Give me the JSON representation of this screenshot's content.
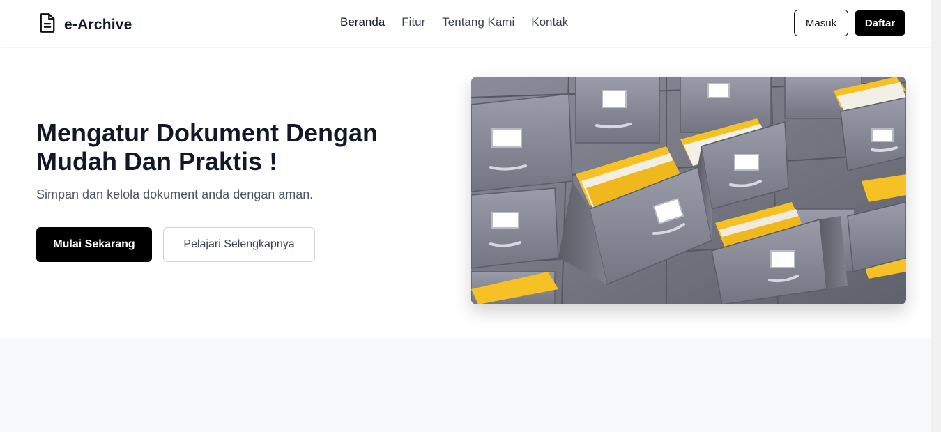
{
  "header": {
    "brand": "e-Archive",
    "nav": [
      {
        "label": "Beranda",
        "active": true
      },
      {
        "label": "Fitur",
        "active": false
      },
      {
        "label": "Tentang Kami",
        "active": false
      },
      {
        "label": "Kontak",
        "active": false
      }
    ],
    "login_label": "Masuk",
    "register_label": "Daftar"
  },
  "hero": {
    "title_line1": "Mengatur Dokument Dengan",
    "title_line2": "Mudah Dan Praktis !",
    "subtitle": "Simpan dan kelola dokument anda dengan aman.",
    "primary_cta": "Mulai Sekarang",
    "secondary_cta": "Pelajari Selengkapnya"
  },
  "colors": {
    "primary": "#000000",
    "text": "#111827",
    "muted": "#4b5563",
    "section_bg": "#f8f9fb",
    "cabinet": "#7d7f8c",
    "folder": "#f5c125"
  }
}
